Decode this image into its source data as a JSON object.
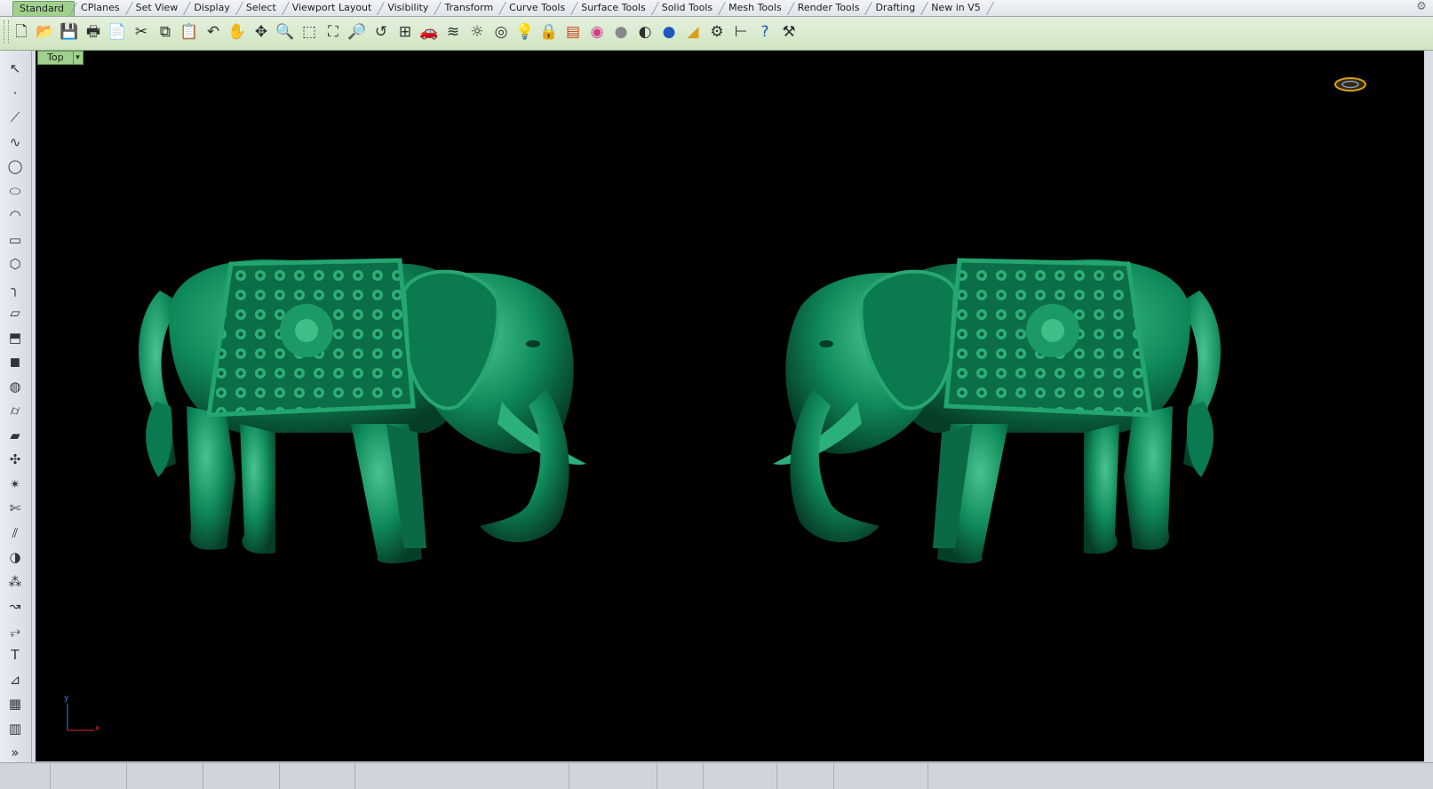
{
  "tabs": [
    {
      "label": "Standard",
      "active": true
    },
    {
      "label": "CPlanes"
    },
    {
      "label": "Set View"
    },
    {
      "label": "Display"
    },
    {
      "label": "Select"
    },
    {
      "label": "Viewport Layout"
    },
    {
      "label": "Visibility"
    },
    {
      "label": "Transform"
    },
    {
      "label": "Curve Tools"
    },
    {
      "label": "Surface Tools"
    },
    {
      "label": "Solid Tools"
    },
    {
      "label": "Mesh Tools"
    },
    {
      "label": "Render Tools"
    },
    {
      "label": "Drafting"
    },
    {
      "label": "New in V5"
    }
  ],
  "tab_options_icon": "gear-icon",
  "toolbar_icons": [
    "new-file-icon",
    "open-file-icon",
    "save-icon",
    "print-icon",
    "import-icon",
    "cut-icon",
    "copy-icon",
    "paste-icon",
    "undo-icon",
    "pan-icon",
    "rotate-view-icon",
    "zoom-dynamic-icon",
    "zoom-window-icon",
    "zoom-extents-icon",
    "zoom-selected-icon",
    "undo-view-icon",
    "four-viewports-icon",
    "car-icon",
    "layer-icon",
    "lights-icon",
    "snapshot-icon",
    "bulb-icon",
    "lock-icon",
    "properties-icon",
    "color-wheel-icon",
    "render-sphere-icon",
    "shaded-sphere-icon",
    "blue-sphere-icon",
    "cone-icon",
    "gear-options-icon",
    "dimension-icon",
    "help-icon",
    "tools-icon"
  ],
  "side_icons": [
    "select-arrow-icon",
    "point-icon",
    "polyline-icon",
    "curve-icon",
    "circle-icon",
    "ellipse-icon",
    "arc-icon",
    "rectangle-icon",
    "polygon-icon",
    "fillet-icon",
    "surface-icon",
    "extrude-icon",
    "box-icon",
    "sphere-icon",
    "cylinder-icon",
    "patch-icon",
    "transform-icon",
    "explode-icon",
    "trim-icon",
    "split-icon",
    "boolean-icon",
    "group-icon",
    "curve-edit-icon",
    "offset-icon",
    "text-icon",
    "dimension-side-icon",
    "block-icon",
    "layout-icon",
    "more-icon"
  ],
  "viewport": {
    "name": "Top",
    "dropdown": "▾",
    "axis_x": "x",
    "axis_y": "y",
    "background": "#000000",
    "model_color": "#0f8a5a"
  }
}
